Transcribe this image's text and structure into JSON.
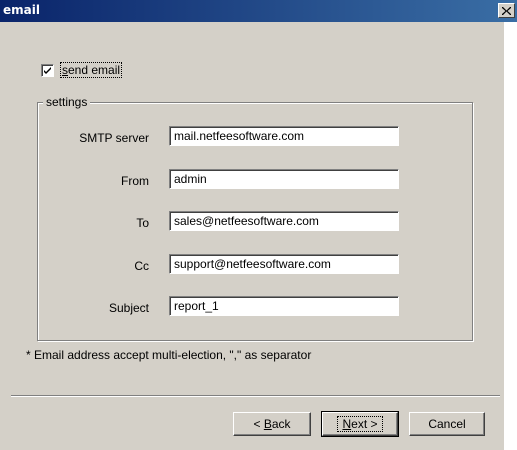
{
  "window": {
    "title": "email",
    "close_glyph": "✕"
  },
  "send_email": {
    "checked": true,
    "label_prefix": "",
    "label_mnemonic": "s",
    "label_rest": "end email"
  },
  "settings": {
    "legend": "settings",
    "fields": [
      {
        "label": "SMTP server",
        "value": "mail.netfeesoftware.com"
      },
      {
        "label": "From",
        "value": "admin"
      },
      {
        "label": "To",
        "value": "sales@netfeesoftware.com"
      },
      {
        "label": "Cc",
        "value": "support@netfeesoftware.com"
      },
      {
        "label": "Subject",
        "value": "report_1"
      }
    ]
  },
  "note": "* Email address accept multi-election, \",\" as separator",
  "buttons": {
    "back": {
      "pre": "< ",
      "mnemonic": "B",
      "rest": "ack"
    },
    "next": {
      "pre": "",
      "mnemonic": "N",
      "rest": "ext >"
    },
    "cancel": "Cancel"
  },
  "icons": {
    "close": "close-icon",
    "check": "check-icon"
  }
}
